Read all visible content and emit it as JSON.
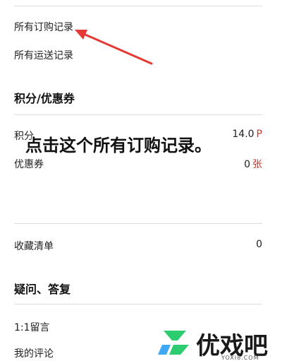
{
  "records": {
    "order_label": "所有订购记录",
    "shipping_label": "所有运送记录"
  },
  "points_coupons": {
    "title": "积分/优惠券",
    "points_label": "积分",
    "points_value": "14.0",
    "points_unit": "P",
    "coupon_label": "优惠券",
    "coupon_value": "0",
    "coupon_unit": "张"
  },
  "wishlist": {
    "label": "收藏清单",
    "count": "0"
  },
  "qa": {
    "title": "疑问、答复",
    "message_label": "1:1留言",
    "review_label": "我的评论"
  },
  "annotation": {
    "caption": "点击这个所有订购记录。",
    "arrow_color": "#e53935"
  },
  "watermark": {
    "brand": "优戏吧",
    "domain": "YOXI8.COM",
    "colors": {
      "green": "#2ecc71",
      "blue": "#3fa9f5"
    }
  }
}
